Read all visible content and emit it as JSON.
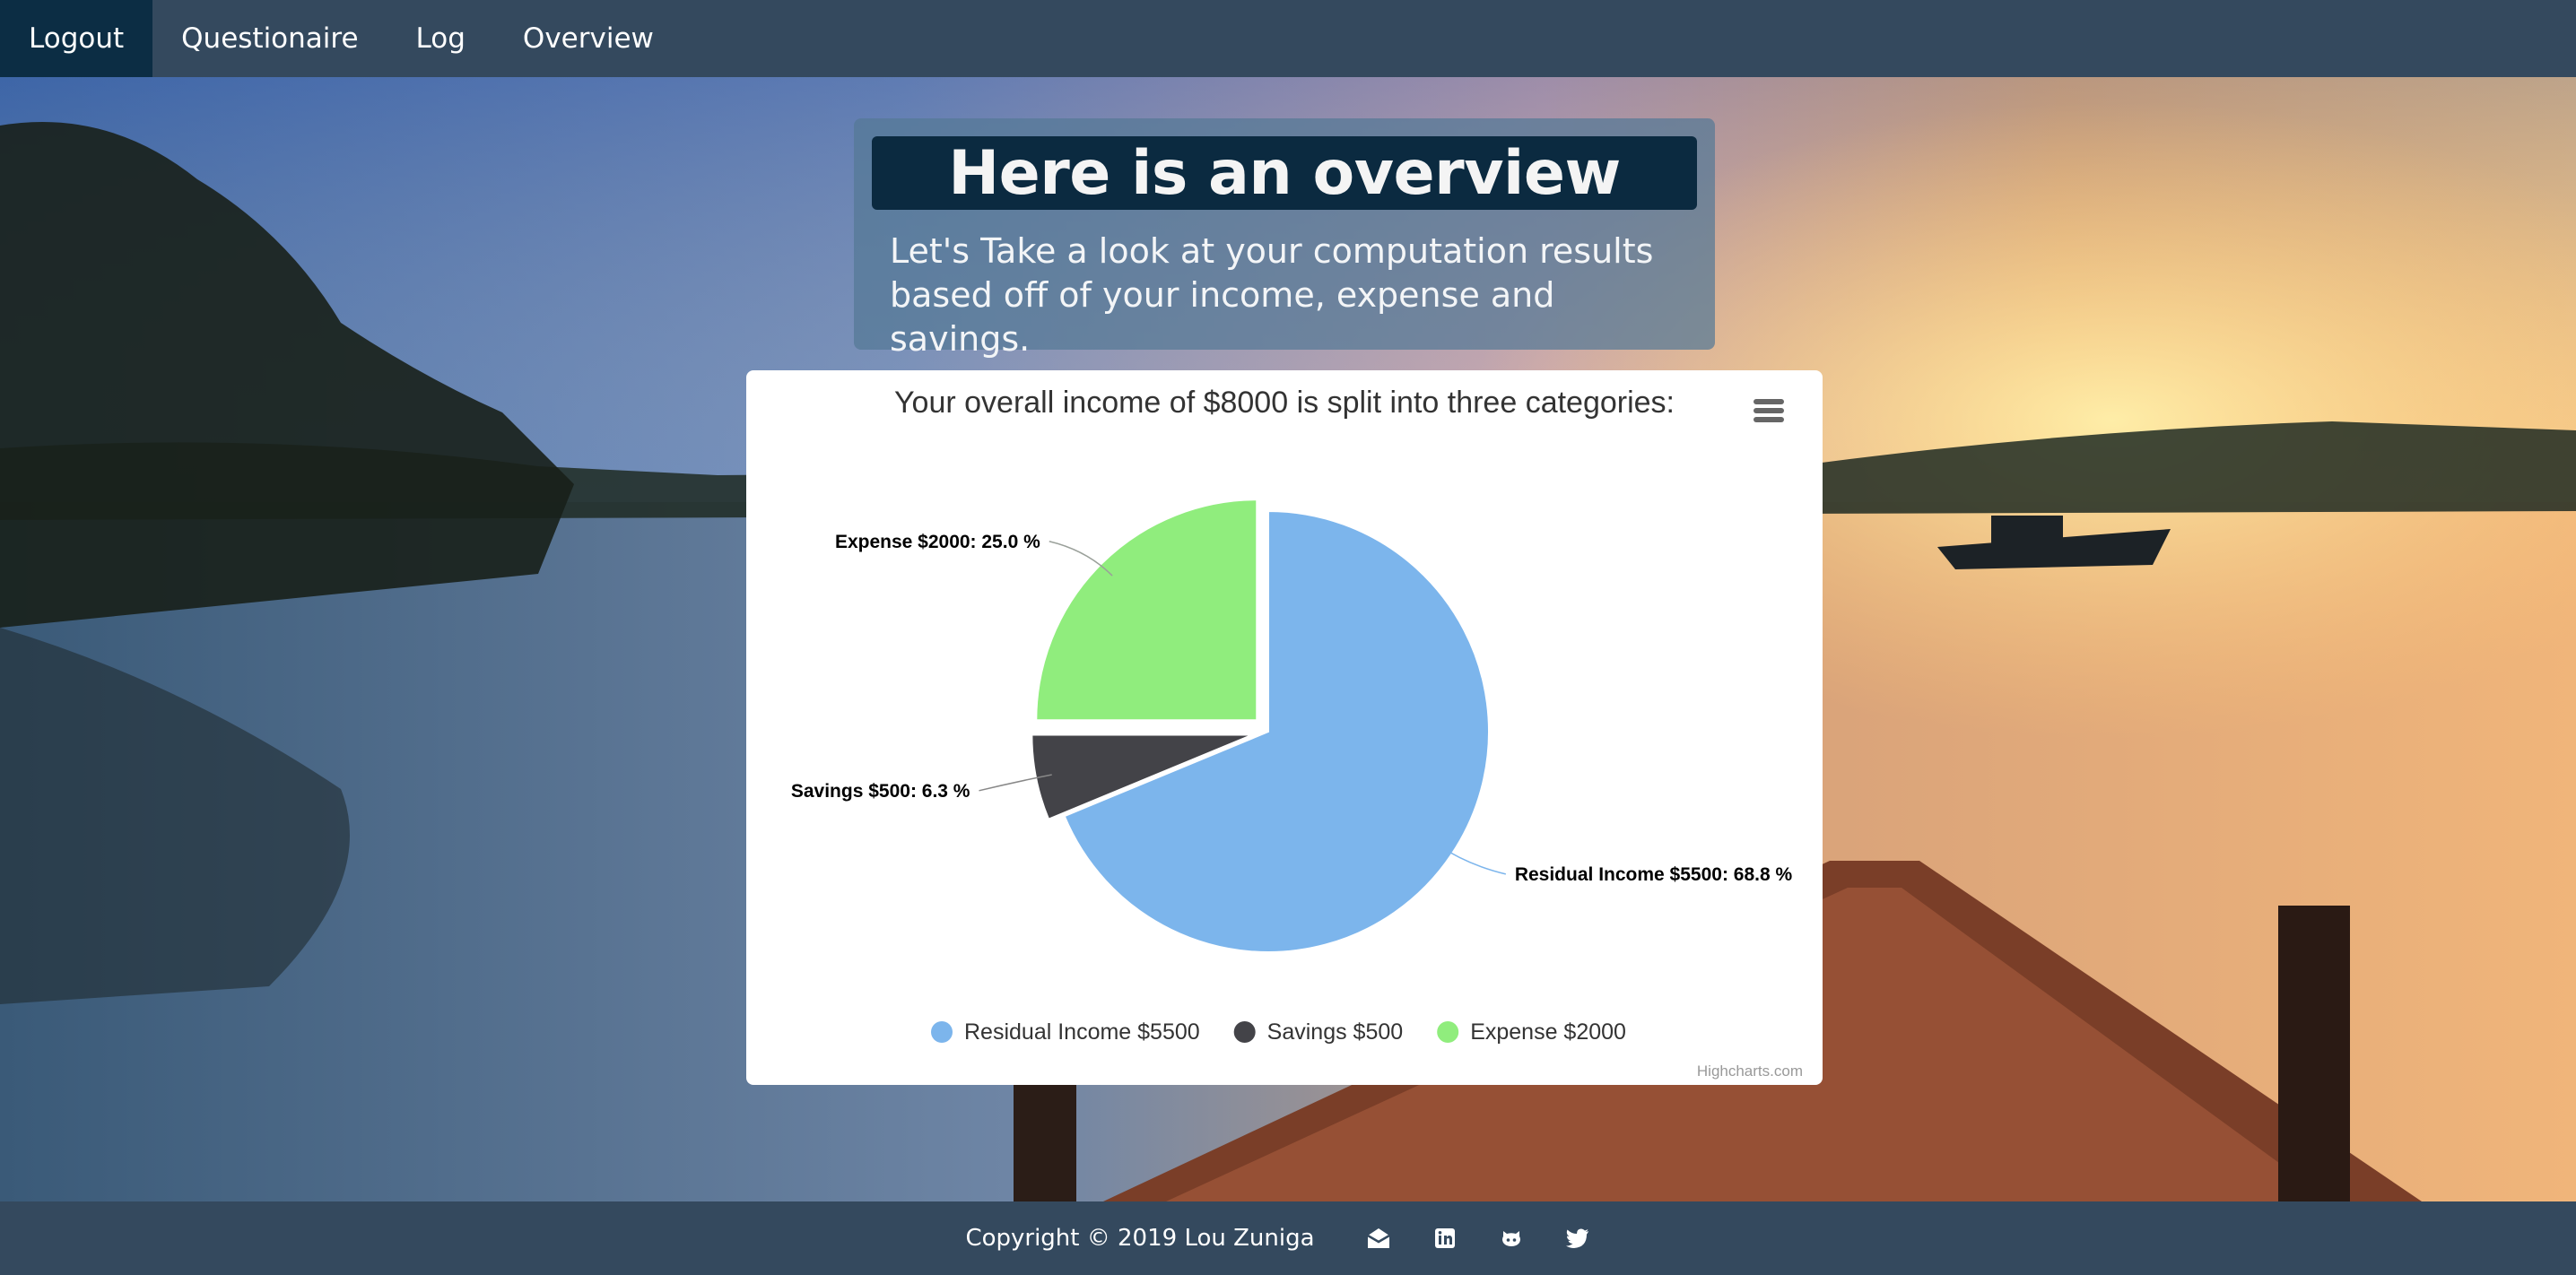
{
  "nav": {
    "items": [
      {
        "label": "Logout",
        "active": true
      },
      {
        "label": "Questionaire",
        "active": false
      },
      {
        "label": "Log",
        "active": false
      },
      {
        "label": "Overview",
        "active": false
      }
    ]
  },
  "header": {
    "title": "Here is an overview",
    "subtitle_line1": "Let's Take a look at your computation results",
    "subtitle_line2": "based off of your income, expense and savings."
  },
  "chart_data": {
    "type": "pie",
    "title": "Your overall income of $8000 is split into three categories:",
    "slices": [
      {
        "name": "Residual Income $5500",
        "value": 5500,
        "label": "Residual Income $5500: 68.8 %",
        "color": "#7cb5ec"
      },
      {
        "name": "Savings $500",
        "value": 500,
        "label": "Savings $500: 6.3 %",
        "color": "#434348"
      },
      {
        "name": "Expense $2000",
        "value": 2000,
        "label": "Expense $2000: 25.0 %",
        "color": "#90ed7d"
      }
    ],
    "legend_position": "bottom-center",
    "credits": "Highcharts.com",
    "menu_icon": "hamburger-menu-icon"
  },
  "footer": {
    "copyright": "Copyright © 2019 Lou Zuniga",
    "icons": [
      "email-icon",
      "linkedin-icon",
      "github-icon",
      "twitter-icon"
    ]
  },
  "colors": {
    "nav_bg": "#34495e",
    "nav_active": "#0c2d44",
    "header_title_bg": "#0b2a40"
  }
}
